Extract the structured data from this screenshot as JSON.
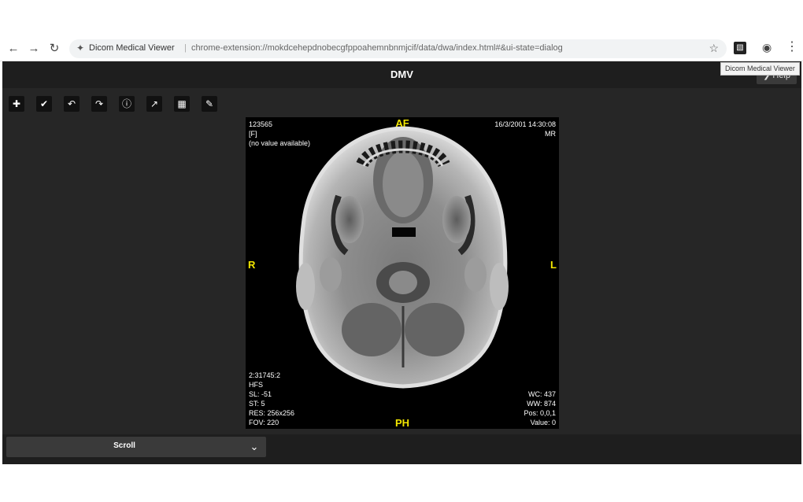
{
  "browser": {
    "site_name": "Dicom Medical Viewer",
    "separator": "|",
    "url": "chrome-extension://mokdcehepdnobecgfppoahemnbnmjcif/data/dwa/index.html#&ui-state=dialog",
    "extension_tooltip": "Dicom Medical Viewer"
  },
  "app": {
    "title": "DMV",
    "help_label": "Help"
  },
  "toolbar": {
    "icons": [
      "add-icon",
      "check-icon",
      "undo-icon",
      "redo-icon",
      "info-icon",
      "export-icon",
      "grid-icon",
      "edit-icon"
    ]
  },
  "overlay": {
    "top_left": [
      "123565",
      "[F]",
      "(no value available)"
    ],
    "top_right": [
      "16/3/2001 14:30:08",
      "MR"
    ],
    "bottom_left": [
      "2:31745:2",
      "HFS",
      "SL: -51",
      "ST: 5",
      "RES: 256x256",
      "FOV: 220"
    ],
    "bottom_right": [
      "WC: 437",
      "WW: 874",
      "Pos: 0,0,1",
      "Value: 0"
    ]
  },
  "orientation": {
    "top": "AF",
    "bottom": "PH",
    "left": "R",
    "right": "L"
  },
  "bottom": {
    "mode_label": "Scroll"
  }
}
